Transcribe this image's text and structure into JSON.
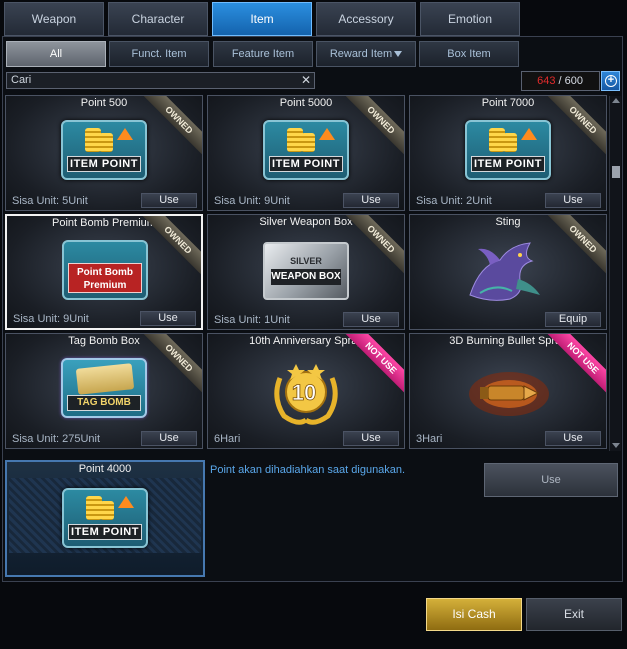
{
  "main_tabs": [
    {
      "label": "Weapon"
    },
    {
      "label": "Character"
    },
    {
      "label": "Item"
    },
    {
      "label": "Accessory"
    },
    {
      "label": "Emotion"
    }
  ],
  "sub_tabs": [
    {
      "label": "All"
    },
    {
      "label": "Funct. Item"
    },
    {
      "label": "Feature Item"
    },
    {
      "label": "Reward Item"
    },
    {
      "label": "Box Item"
    }
  ],
  "search": {
    "value": "Cari",
    "clear": "✕"
  },
  "inventory": {
    "used": "643",
    "sep": "/",
    "capacity": "600"
  },
  "items": [
    {
      "name": "Point 500",
      "unit": "Sisa Unit: 5Unit",
      "action": "Use",
      "ribbon": "OWNED",
      "icon_text": "ITEM POINT"
    },
    {
      "name": "Point 5000",
      "unit": "Sisa Unit: 9Unit",
      "action": "Use",
      "ribbon": "OWNED",
      "icon_text": "ITEM POINT"
    },
    {
      "name": "Point 7000",
      "unit": "Sisa Unit: 2Unit",
      "action": "Use",
      "ribbon": "OWNED",
      "icon_text": "ITEM POINT"
    },
    {
      "name": "Point Bomb Premium",
      "unit": "Sisa Unit: 9Unit",
      "action": "Use",
      "ribbon": "OWNED",
      "icon_text": "Point Bomb Premium"
    },
    {
      "name": "Silver Weapon Box",
      "unit": "Sisa Unit: 1Unit",
      "action": "Use",
      "ribbon": "OWNED",
      "icon_text_top": "SILVER",
      "icon_text": "WEAPON BOX"
    },
    {
      "name": "Sting",
      "unit": "",
      "action": "Equip",
      "ribbon": "OWNED"
    },
    {
      "name": "Tag Bomb Box",
      "unit": "Sisa Unit: 275Unit",
      "action": "Use",
      "ribbon": "OWNED",
      "icon_text": "TAG BOMB"
    },
    {
      "name": "10th Anniversary Spray",
      "unit": "6Hari",
      "action": "Use",
      "ribbon": "NOT USE",
      "icon_text": "10"
    },
    {
      "name": "3D Burning Bullet Spray",
      "unit": "3Hari",
      "action": "Use",
      "ribbon": "NOT USE"
    }
  ],
  "detail": {
    "name": "Point 4000",
    "icon_text": "ITEM POINT",
    "description": "Point akan dihadiahkan saat digunakan.",
    "use_label": "Use"
  },
  "footer": {
    "cash_label": "Isi Cash",
    "exit_label": "Exit"
  },
  "colors": {
    "accent": "#1f78c8",
    "counter_used": "#e22b2b",
    "cash": "#c9a22c",
    "not_use_ribbon": "#e0308a"
  }
}
